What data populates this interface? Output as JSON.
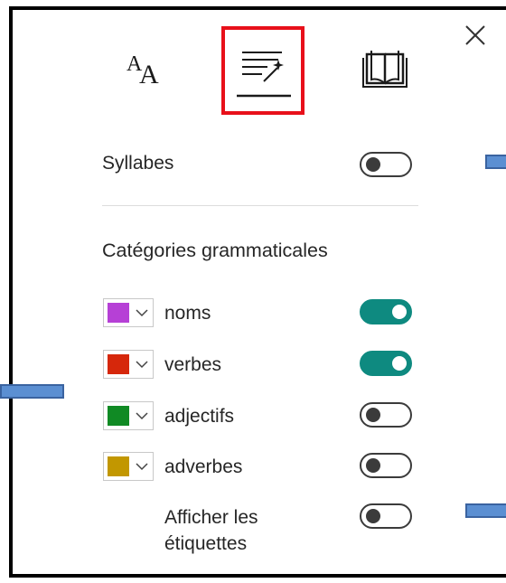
{
  "header": {
    "close_icon": "close-icon",
    "tabs": [
      {
        "name": "text-preferences",
        "icon": "font-size-icon",
        "glyph_big": "A",
        "glyph_small": "A",
        "selected": false
      },
      {
        "name": "grammar-options",
        "icon": "grammar-wand-icon",
        "selected": true
      },
      {
        "name": "reading-preferences",
        "icon": "book-icon",
        "selected": false
      }
    ]
  },
  "syllables": {
    "label": "Syllabes",
    "enabled": false
  },
  "parts_of_speech": {
    "title": "Catégories grammaticales",
    "items": [
      {
        "label": "noms",
        "color": "#b640d6",
        "enabled": true
      },
      {
        "label": "verbes",
        "color": "#d6270b",
        "enabled": true
      },
      {
        "label": "adjectifs",
        "color": "#108a24",
        "enabled": false
      },
      {
        "label": "adverbes",
        "color": "#c29700",
        "enabled": false
      }
    ],
    "show_labels": {
      "label_line1": "Afficher les",
      "label_line2": "étiquettes",
      "enabled": false
    }
  },
  "colors": {
    "toggle_on": "#0e8a80",
    "highlight": "#e8101a",
    "annotation_pointer": "#5b8fd2"
  }
}
